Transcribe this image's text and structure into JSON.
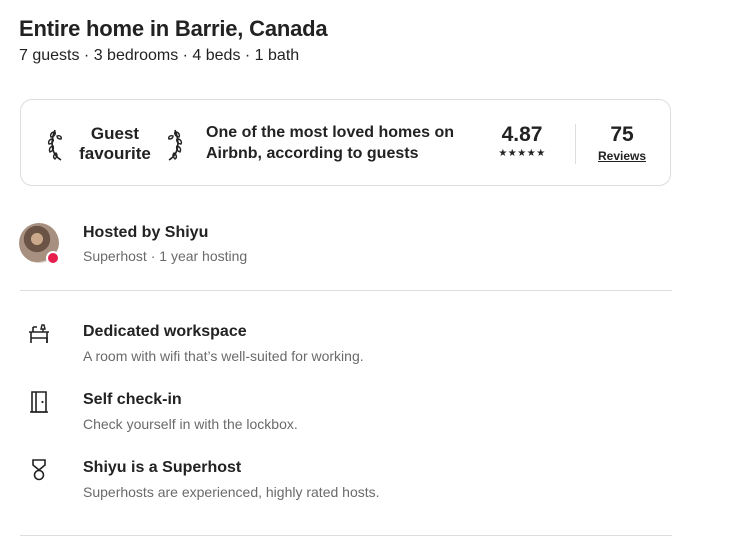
{
  "listing": {
    "title": "Entire home in Barrie, Canada",
    "summary": "7 guests · 3 bedrooms · 4 beds · 1 bath"
  },
  "guest_favourite": {
    "badge_line1": "Guest",
    "badge_line2": "favourite",
    "description": "One of the most loved homes on Airbnb, according to guests",
    "rating": "4.87",
    "stars": "★★★★★",
    "star_count": 5,
    "reviews_count": "75",
    "reviews_label": "Reviews"
  },
  "host": {
    "title": "Hosted by Shiyu",
    "subtitle": "Superhost · 1 year hosting"
  },
  "highlights": [
    {
      "icon": "desk-icon",
      "title": "Dedicated workspace",
      "description": "A room with wifi that’s well-suited for working."
    },
    {
      "icon": "door-icon",
      "title": "Self check-in",
      "description": "Check yourself in with the lockbox."
    },
    {
      "icon": "superhost-medal-icon",
      "title": "Shiyu is a Superhost",
      "description": "Superhosts are experienced, highly rated hosts."
    }
  ],
  "colors": {
    "text": "#222222",
    "secondary_text": "#6a6a6a",
    "border": "#dddddd",
    "superhost_badge": "#e61e4d"
  }
}
